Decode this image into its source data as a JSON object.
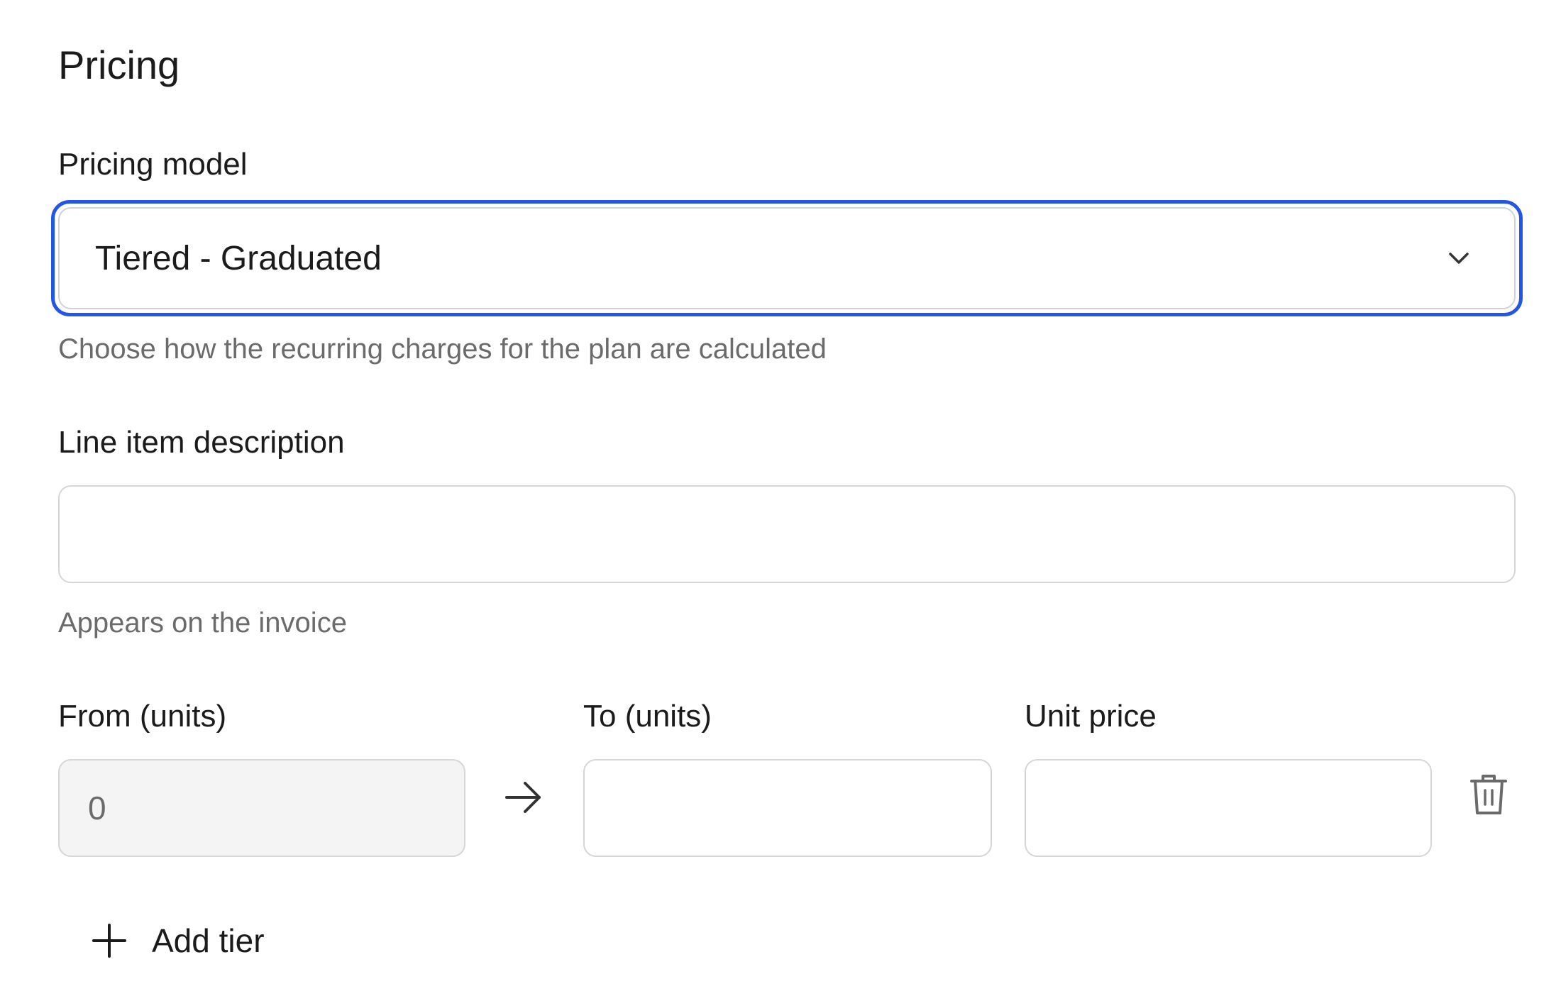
{
  "section": {
    "title": "Pricing"
  },
  "pricing_model": {
    "label": "Pricing model",
    "selected": "Tiered - Graduated",
    "helper": "Choose how the recurring charges for the plan are calculated"
  },
  "line_item": {
    "label": "Line item description",
    "value": "",
    "helper": "Appears on the invoice"
  },
  "tiers": {
    "from_label": "From (units)",
    "to_label": "To (units)",
    "price_label": "Unit price",
    "rows": [
      {
        "from": "0",
        "to": "",
        "unit_price": ""
      }
    ],
    "add_label": "Add tier"
  },
  "colors": {
    "focus_ring": "#2456e6",
    "border": "#d6d6d6",
    "helper_text": "#6b6b6b",
    "disabled_bg": "#f4f4f4"
  },
  "icons": {
    "select": "chevron-down-icon",
    "tier_separator": "arrow-right-icon",
    "delete": "trash-icon",
    "add": "plus-icon"
  }
}
